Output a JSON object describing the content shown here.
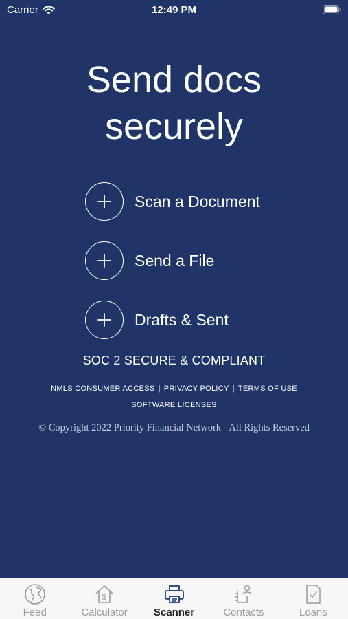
{
  "status_bar": {
    "carrier": "Carrier",
    "time": "12:49 PM"
  },
  "headline": {
    "line1": "Send docs",
    "line2": "securely"
  },
  "actions": [
    {
      "label": "Scan a Document",
      "icon": "plus-icon"
    },
    {
      "label": "Send a File",
      "icon": "plus-icon"
    },
    {
      "label": "Drafts & Sent",
      "icon": "plus-icon"
    }
  ],
  "compliance": "SOC 2 SECURE & COMPLIANT",
  "legal": {
    "nmls": "NMLS CONSUMER ACCESS",
    "privacy": "PRIVACY POLICY",
    "terms": "TERMS OF USE",
    "separator": "|",
    "licenses": "SOFTWARE LICENSES"
  },
  "copyright": "© Copyright 2022 Priority Financial Network - All Rights Reserved",
  "tabs": [
    {
      "label": "Feed",
      "icon": "globe-icon"
    },
    {
      "label": "Calculator",
      "icon": "calculator-home-icon"
    },
    {
      "label": "Scanner",
      "icon": "printer-icon",
      "active": true
    },
    {
      "label": "Contacts",
      "icon": "contacts-icon"
    },
    {
      "label": "Loans",
      "icon": "document-check-icon"
    }
  ],
  "colors": {
    "background": "#213468",
    "tab_bar": "#f7f7f7",
    "tab_inactive": "#9a9a9a",
    "tab_active": "#222222"
  }
}
